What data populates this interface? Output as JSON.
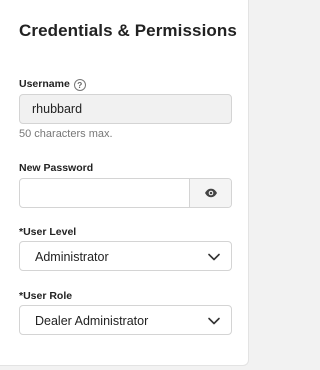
{
  "section": {
    "title": "Credentials & Permissions"
  },
  "username": {
    "label": "Username",
    "value": "rhubbard",
    "hint": "50 characters max."
  },
  "password": {
    "label": "New Password",
    "value": ""
  },
  "user_level": {
    "label": "*User Level",
    "value": "Administrator"
  },
  "user_role": {
    "label": "*User Role",
    "value": "Dealer Administrator"
  },
  "icons": {
    "help": "question-circle-icon",
    "eye": "eye-icon",
    "chevron": "chevron-down-icon"
  }
}
